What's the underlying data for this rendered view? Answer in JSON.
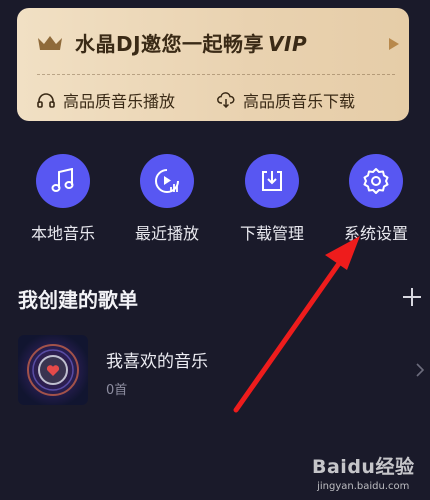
{
  "vip_card": {
    "title_prefix": "水晶DJ邀您一起畅享",
    "title_vip": "VIP",
    "perks": [
      {
        "icon": "headphones-icon",
        "label": "高品质音乐播放"
      },
      {
        "icon": "cloud-download-icon",
        "label": "高品质音乐下载"
      }
    ]
  },
  "shortcuts": [
    {
      "icon": "music-note-icon",
      "label": "本地音乐"
    },
    {
      "icon": "recent-play-icon",
      "label": "最近播放"
    },
    {
      "icon": "download-icon",
      "label": "下载管理"
    },
    {
      "icon": "gear-icon",
      "label": "系统设置"
    }
  ],
  "section": {
    "title": "我创建的歌单"
  },
  "playlists": [
    {
      "name": "我喜欢的音乐",
      "count": "0首"
    }
  ],
  "watermark": {
    "brand": "Baidu经验",
    "url": "jingyan.baidu.com"
  },
  "colors": {
    "background": "#1a1a2a",
    "accent": "#5857f2",
    "vip_gold": "#e9d2b0",
    "annotation_arrow": "#ee1c1c"
  }
}
